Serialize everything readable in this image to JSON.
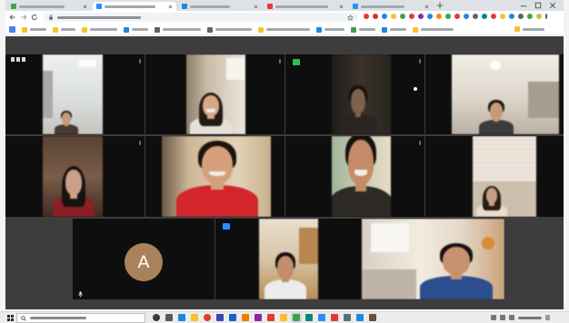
{
  "browser": {
    "tabs": [
      {
        "favicon": "page-icon",
        "active": false
      },
      {
        "favicon": "page-icon",
        "active": true
      },
      {
        "favicon": "page-icon",
        "active": false
      },
      {
        "favicon": "page-icon",
        "active": false
      },
      {
        "favicon": "page-icon",
        "active": false
      }
    ],
    "nav_icons": [
      "back-icon",
      "forward-icon",
      "reload-icon"
    ],
    "window_controls": [
      "minimize-icon",
      "maximize-icon",
      "close-icon"
    ]
  },
  "meeting": {
    "participants": [
      {
        "camera_on": true
      },
      {
        "camera_on": true
      },
      {
        "camera_on": true,
        "badge": "active-speaker"
      },
      {
        "camera_on": true
      },
      {
        "camera_on": true
      },
      {
        "camera_on": true
      },
      {
        "camera_on": true
      },
      {
        "camera_on": true
      },
      {
        "camera_on": false,
        "avatar_letter": "A"
      },
      {
        "camera_on": true,
        "badge": "video-on"
      },
      {
        "camera_on": true
      }
    ]
  },
  "colors": {
    "meeting_bg": "#3d3d3d",
    "tile_bg": "#0e0e0e",
    "avatar_bg": "#a9825a",
    "active_badge": "#2fbf4a",
    "video_badge": "#2d8cff"
  }
}
